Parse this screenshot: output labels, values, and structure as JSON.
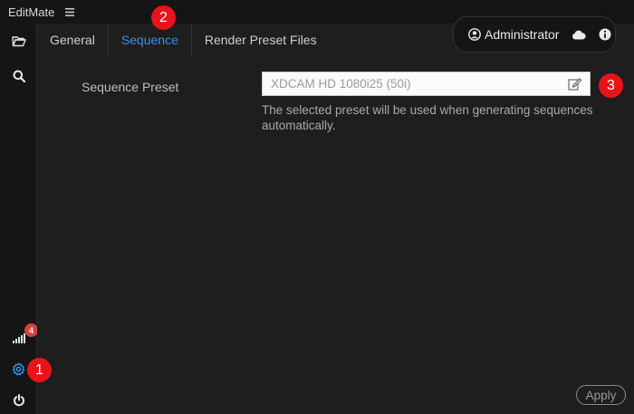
{
  "app": {
    "title": "EditMate"
  },
  "tabs": [
    {
      "label": "General"
    },
    {
      "label": "Sequence"
    },
    {
      "label": "Render Preset Files"
    }
  ],
  "user": {
    "name": "Administrator"
  },
  "sidebar": {
    "notification_count": "4"
  },
  "settings": {
    "sequence_preset_label": "Sequence Preset",
    "sequence_preset_value": "XDCAM HD 1080i25 (50i)",
    "hint": "The selected preset will be used when generating sequences automatically."
  },
  "actions": {
    "apply_label": "Apply"
  },
  "markers": [
    "1",
    "2",
    "3"
  ],
  "icons": [
    "menu-icon",
    "folder-open-icon",
    "search-icon",
    "signal-icon",
    "gear-icon",
    "power-icon",
    "user-circle-icon",
    "cloud-icon",
    "info-icon",
    "edit-icon"
  ],
  "colors": {
    "accent": "#3d8fe0",
    "badge": "#d9413b",
    "marker": "#e8141a"
  }
}
